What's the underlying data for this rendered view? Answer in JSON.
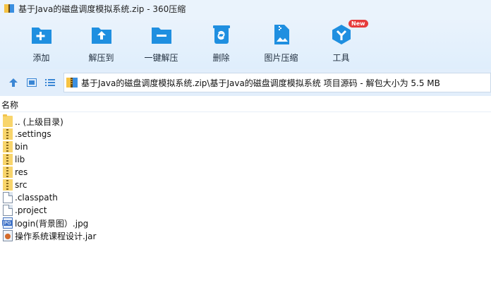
{
  "window": {
    "title": "基于Java的磁盘调度模拟系统.zip - 360压缩"
  },
  "toolbar": {
    "buttons": [
      {
        "label": "添加",
        "icon": "add-icon"
      },
      {
        "label": "解压到",
        "icon": "extract-to-icon"
      },
      {
        "label": "一键解压",
        "icon": "one-click-extract-icon"
      },
      {
        "label": "删除",
        "icon": "delete-icon"
      },
      {
        "label": "图片压缩",
        "icon": "image-compress-icon"
      },
      {
        "label": "工具",
        "icon": "tools-icon",
        "badge": "New"
      }
    ]
  },
  "address": {
    "path": "基于Java的磁盘调度模拟系统.zip\\基于Java的磁盘调度模拟系统 项目源码 - 解包大小为 5.5 MB"
  },
  "list": {
    "column_name": "名称",
    "items": [
      {
        "name": ".. (上级目录)",
        "type": "folder-up"
      },
      {
        "name": ".settings",
        "type": "folder-zip"
      },
      {
        "name": "bin",
        "type": "folder-zip"
      },
      {
        "name": "lib",
        "type": "folder-zip"
      },
      {
        "name": "res",
        "type": "folder-zip"
      },
      {
        "name": "src",
        "type": "folder-zip"
      },
      {
        "name": ".classpath",
        "type": "file"
      },
      {
        "name": ".project",
        "type": "file"
      },
      {
        "name": "login(背景图）.jpg",
        "type": "jpg"
      },
      {
        "name": "操作系统课程设计.jar",
        "type": "jar"
      }
    ]
  },
  "colors": {
    "accent": "#1f8fe0",
    "toolbar_bg": "#dfeefc",
    "badge": "#e63b3b"
  }
}
